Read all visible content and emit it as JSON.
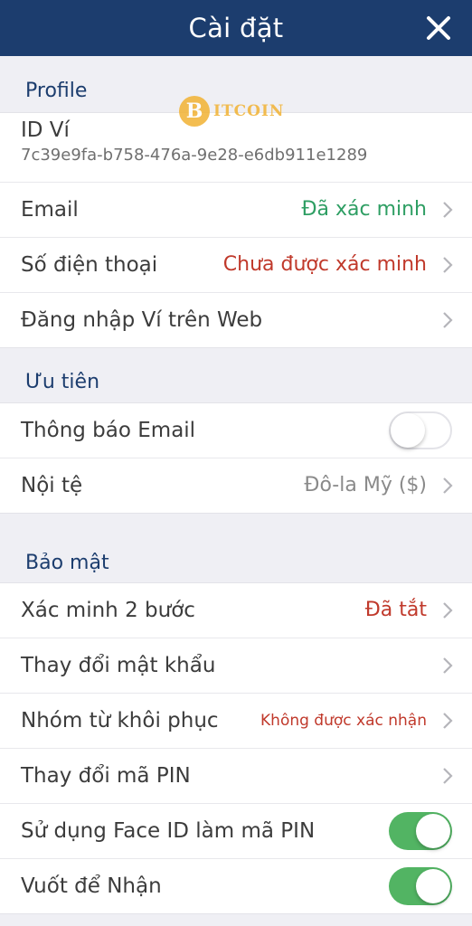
{
  "header": {
    "title": "Cài đặt"
  },
  "profile": {
    "section_title": "Profile",
    "wallet_id_label": "ID Ví",
    "wallet_id_value": "7c39e9fa-b758-476a-9e28-e6db911e1289",
    "email_label": "Email",
    "email_status": "Đã xác minh",
    "phone_label": "Số điện thoại",
    "phone_status": "Chưa được xác minh",
    "web_login_label": "Đăng nhập Ví trên Web"
  },
  "preferences": {
    "section_title": "Ưu tiên",
    "email_notify_label": "Thông báo Email",
    "email_notify_on": false,
    "currency_label": "Nội tệ",
    "currency_value": "Đô-la Mỹ ($)"
  },
  "security": {
    "section_title": "Bảo mật",
    "two_step_label": "Xác minh 2 bước",
    "two_step_status": "Đã tắt",
    "change_password_label": "Thay đổi mật khẩu",
    "recovery_label": "Nhóm từ khôi phục",
    "recovery_status": "Không được xác nhận",
    "change_pin_label": "Thay đổi mã PIN",
    "face_id_label": "Sử dụng Face ID làm mã PIN",
    "face_id_on": true,
    "swipe_receive_label": "Vuốt để Nhận",
    "swipe_receive_on": true
  },
  "watermark": {
    "text": "ITCOIN",
    "coin_letter": "B"
  },
  "colors": {
    "header_bg": "#1c3d6e",
    "accent_text": "#1c3d6e",
    "verified": "#2e9e63",
    "warning": "#c0392b",
    "toggle_on": "#52b463"
  }
}
